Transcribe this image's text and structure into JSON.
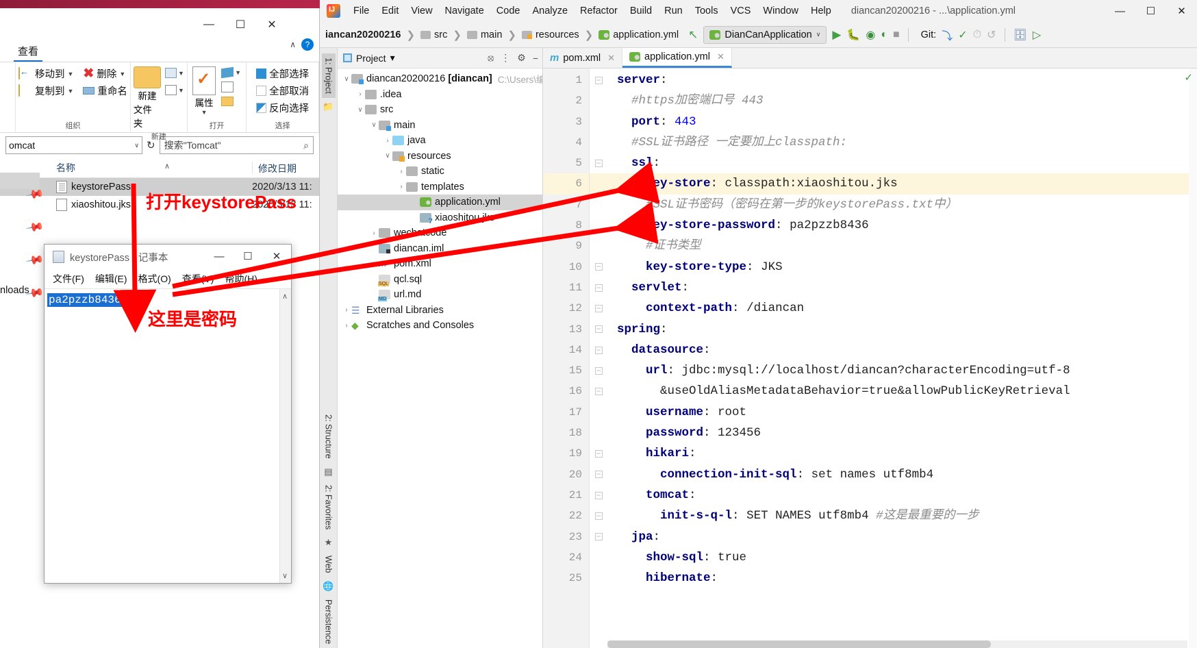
{
  "explorer": {
    "window_buttons": {
      "minimize": "—",
      "maximize": "☐",
      "close": "✕"
    },
    "help_glyph": "?",
    "chevron_glyph": "∧",
    "ribbon_tab": "查看",
    "groups": [
      {
        "label": "组织",
        "items": [
          "移动到",
          "删除",
          "复制到",
          "重命名"
        ]
      },
      {
        "label": "新建",
        "items": [
          "新建",
          "文件夹"
        ]
      },
      {
        "label": "打开",
        "items": [
          "属性"
        ]
      },
      {
        "label": "选择",
        "items": [
          "全部选择",
          "全部取消",
          "反向选择"
        ]
      }
    ],
    "address_value": "omcat",
    "address_caret": "∨",
    "refresh_glyph": "↻",
    "search_placeholder": "搜索\"Tomcat\"",
    "search_icon": "⌕",
    "columns": {
      "name": "名称",
      "date": "修改日期"
    },
    "sort_caret": "∧",
    "files": [
      {
        "name": "keystorePass",
        "date": "2020/3/13 11:",
        "selected": true
      },
      {
        "name": "xiaoshitou.jks",
        "date": "2020/3/13 11:",
        "selected": false
      }
    ],
    "sidebar_downloads": "nloads"
  },
  "notepad": {
    "title": "keystorePass - 记事本",
    "window_buttons": {
      "minimize": "—",
      "maximize": "☐",
      "close": "✕"
    },
    "menu": [
      "文件(F)",
      "编辑(E)",
      "格式(O)",
      "查看(V)",
      "帮助(H)"
    ],
    "content": "pa2pzzb8436",
    "scroll_up": "∧",
    "scroll_down": "∨"
  },
  "annotations": {
    "open_keystore": "打开keystorePass",
    "here_is_password": "这里是密码",
    "color": "#ff0000"
  },
  "idea": {
    "menu": [
      "File",
      "Edit",
      "View",
      "Navigate",
      "Code",
      "Analyze",
      "Refactor",
      "Build",
      "Run",
      "Tools",
      "VCS",
      "Window",
      "Help"
    ],
    "window_title": "diancan20200216 - ...\\application.yml",
    "window_buttons": {
      "minimize": "—",
      "maximize": "☐",
      "close": "✕"
    },
    "breadcrumbs": [
      "iancan20200216",
      "src",
      "main",
      "resources",
      "application.yml"
    ],
    "back_arrow": "↖",
    "run_config": "DianCanApplication",
    "run_config_caret": "∨",
    "toolbar_icons": [
      "run",
      "debug",
      "run-with-coverage",
      "profile",
      "stop"
    ],
    "git_label": "Git:",
    "git_icons": [
      "update-project",
      "commit",
      "history",
      "rollback"
    ],
    "right_icons": [
      "project-structure",
      "run-anything"
    ],
    "stripe_left": [
      "1: Project",
      "2: Structure",
      "2: Favorites",
      "Web",
      "Persistence"
    ],
    "project_pane": {
      "title": "Project",
      "title_caret": "▾",
      "actions": [
        "target-icon",
        "collapse-icon",
        "gear-icon",
        "hide-icon"
      ],
      "tree": [
        {
          "depth": 0,
          "twisty": "∨",
          "icon": "ic-folder-mod",
          "label": "diancan20200216",
          "bold": "[diancan]",
          "path": "C:\\Users\\编",
          "sel": false
        },
        {
          "depth": 1,
          "twisty": "›",
          "icon": "ic-folder",
          "label": ".idea",
          "sel": false
        },
        {
          "depth": 1,
          "twisty": "∨",
          "icon": "ic-folder",
          "label": "src",
          "sel": false
        },
        {
          "depth": 2,
          "twisty": "∨",
          "icon": "ic-folder-mod",
          "label": "main",
          "sel": false
        },
        {
          "depth": 3,
          "twisty": "›",
          "icon": "ic-folder-src",
          "label": "java",
          "sel": false
        },
        {
          "depth": 3,
          "twisty": "∨",
          "icon": "ic-folder-res",
          "label": "resources",
          "sel": false
        },
        {
          "depth": 4,
          "twisty": "›",
          "icon": "ic-folder",
          "label": "static",
          "sel": false
        },
        {
          "depth": 4,
          "twisty": "›",
          "icon": "ic-folder",
          "label": "templates",
          "sel": false
        },
        {
          "depth": 5,
          "twisty": "",
          "icon": "ic-yml",
          "label": "application.yml",
          "sel": true
        },
        {
          "depth": 5,
          "twisty": "",
          "icon": "ic-jks",
          "label": "xiaoshitou.jks",
          "sel": false
        },
        {
          "depth": 2,
          "twisty": "›",
          "icon": "ic-folder",
          "label": "wechatcode",
          "sel": false
        },
        {
          "depth": 2,
          "twisty": "",
          "icon": "ic-iml",
          "label": "diancan.iml",
          "sel": false
        },
        {
          "depth": 2,
          "twisty": "",
          "icon": "ic-mvn",
          "label": "pom.xml",
          "sel": false
        },
        {
          "depth": 2,
          "twisty": "",
          "icon": "ic-sql",
          "label": "qcl.sql",
          "sel": false
        },
        {
          "depth": 2,
          "twisty": "",
          "icon": "ic-md",
          "label": "url.md",
          "sel": false
        },
        {
          "depth": 0,
          "twisty": "›",
          "icon": "ic-lib",
          "label": "External Libraries",
          "sel": false
        },
        {
          "depth": 0,
          "twisty": "›",
          "icon": "ic-scratch",
          "label": "Scratches and Consoles",
          "sel": false
        }
      ]
    },
    "tabs": [
      {
        "label": "pom.xml",
        "icon": "maven-icon",
        "active": false,
        "close": "✕"
      },
      {
        "label": "application.yml",
        "icon": "yaml-icon",
        "active": true,
        "close": "✕"
      }
    ],
    "editor": {
      "file": "application.yml",
      "inspection_ok": "✓",
      "lines": [
        {
          "n": 1,
          "fold": "−",
          "hl": false,
          "tokens": [
            {
              "t": "k",
              "v": "server"
            },
            {
              "t": "p",
              "v": ":"
            }
          ]
        },
        {
          "n": 2,
          "fold": "",
          "hl": false,
          "tokens": [
            {
              "t": "p",
              "v": "  "
            },
            {
              "t": "cmt",
              "v": "#https加密端口号 443"
            }
          ]
        },
        {
          "n": 3,
          "fold": "",
          "hl": false,
          "tokens": [
            {
              "t": "p",
              "v": "  "
            },
            {
              "t": "k",
              "v": "port"
            },
            {
              "t": "p",
              "v": ": "
            },
            {
              "t": "num",
              "v": "443"
            }
          ]
        },
        {
          "n": 4,
          "fold": "",
          "hl": false,
          "tokens": [
            {
              "t": "p",
              "v": "  "
            },
            {
              "t": "cmt",
              "v": "#SSL证书路径 一定要加上classpath:"
            }
          ]
        },
        {
          "n": 5,
          "fold": "−",
          "hl": false,
          "tokens": [
            {
              "t": "p",
              "v": "  "
            },
            {
              "t": "k",
              "v": "ssl"
            },
            {
              "t": "p",
              "v": ":"
            }
          ]
        },
        {
          "n": 6,
          "fold": "",
          "hl": true,
          "tokens": [
            {
              "t": "p",
              "v": "    "
            },
            {
              "t": "k",
              "v": "key-store"
            },
            {
              "t": "p",
              "v": ": "
            },
            {
              "t": "val",
              "v": "classpath:xiaoshitou.jks"
            }
          ]
        },
        {
          "n": 7,
          "fold": "",
          "hl": false,
          "tokens": [
            {
              "t": "p",
              "v": "    "
            },
            {
              "t": "cmt",
              "v": "#SSL证书密码（密码在第一步的keystorePass.txt中）"
            }
          ]
        },
        {
          "n": 8,
          "fold": "",
          "hl": false,
          "tokens": [
            {
              "t": "p",
              "v": "    "
            },
            {
              "t": "k",
              "v": "key-store-password"
            },
            {
              "t": "p",
              "v": ": "
            },
            {
              "t": "val",
              "v": "pa2pzzb8436"
            }
          ]
        },
        {
          "n": 9,
          "fold": "",
          "hl": false,
          "tokens": [
            {
              "t": "p",
              "v": "    "
            },
            {
              "t": "cmt",
              "v": "#证书类型"
            }
          ]
        },
        {
          "n": 10,
          "fold": "−",
          "hl": false,
          "tokens": [
            {
              "t": "p",
              "v": "    "
            },
            {
              "t": "k",
              "v": "key-store-type"
            },
            {
              "t": "p",
              "v": ": "
            },
            {
              "t": "val",
              "v": "JKS"
            }
          ]
        },
        {
          "n": 11,
          "fold": "−",
          "hl": false,
          "tokens": [
            {
              "t": "p",
              "v": "  "
            },
            {
              "t": "k",
              "v": "servlet"
            },
            {
              "t": "p",
              "v": ":"
            }
          ]
        },
        {
          "n": 12,
          "fold": "−",
          "hl": false,
          "tokens": [
            {
              "t": "p",
              "v": "    "
            },
            {
              "t": "k",
              "v": "context-path"
            },
            {
              "t": "p",
              "v": ": "
            },
            {
              "t": "val",
              "v": "/diancan"
            }
          ]
        },
        {
          "n": 13,
          "fold": "−",
          "hl": false,
          "tokens": [
            {
              "t": "k",
              "v": "spring"
            },
            {
              "t": "p",
              "v": ":"
            }
          ]
        },
        {
          "n": 14,
          "fold": "−",
          "hl": false,
          "tokens": [
            {
              "t": "p",
              "v": "  "
            },
            {
              "t": "k",
              "v": "datasource"
            },
            {
              "t": "p",
              "v": ":"
            }
          ]
        },
        {
          "n": 15,
          "fold": "−",
          "hl": false,
          "tokens": [
            {
              "t": "p",
              "v": "    "
            },
            {
              "t": "k",
              "v": "url"
            },
            {
              "t": "p",
              "v": ": "
            },
            {
              "t": "val",
              "v": "jdbc:mysql://localhost/diancan?characterEncoding=utf-8"
            }
          ]
        },
        {
          "n": 16,
          "fold": "−",
          "hl": false,
          "tokens": [
            {
              "t": "p",
              "v": "      "
            },
            {
              "t": "val",
              "v": "&useOldAliasMetadataBehavior=true&allowPublicKeyRetrieval"
            }
          ]
        },
        {
          "n": 17,
          "fold": "",
          "hl": false,
          "tokens": [
            {
              "t": "p",
              "v": "    "
            },
            {
              "t": "k",
              "v": "username"
            },
            {
              "t": "p",
              "v": ": "
            },
            {
              "t": "val",
              "v": "root"
            }
          ]
        },
        {
          "n": 18,
          "fold": "",
          "hl": false,
          "tokens": [
            {
              "t": "p",
              "v": "    "
            },
            {
              "t": "k",
              "v": "password"
            },
            {
              "t": "p",
              "v": ": "
            },
            {
              "t": "val",
              "v": "123456"
            }
          ]
        },
        {
          "n": 19,
          "fold": "−",
          "hl": false,
          "tokens": [
            {
              "t": "p",
              "v": "    "
            },
            {
              "t": "k",
              "v": "hikari"
            },
            {
              "t": "p",
              "v": ":"
            }
          ]
        },
        {
          "n": 20,
          "fold": "−",
          "hl": false,
          "tokens": [
            {
              "t": "p",
              "v": "      "
            },
            {
              "t": "k",
              "v": "connection-init-sql"
            },
            {
              "t": "p",
              "v": ": "
            },
            {
              "t": "val",
              "v": "set names utf8mb4"
            }
          ]
        },
        {
          "n": 21,
          "fold": "−",
          "hl": false,
          "tokens": [
            {
              "t": "p",
              "v": "    "
            },
            {
              "t": "k",
              "v": "tomcat"
            },
            {
              "t": "p",
              "v": ":"
            }
          ]
        },
        {
          "n": 22,
          "fold": "−",
          "hl": false,
          "tokens": [
            {
              "t": "p",
              "v": "      "
            },
            {
              "t": "k",
              "v": "init-s-q-l"
            },
            {
              "t": "p",
              "v": ": "
            },
            {
              "t": "val",
              "v": "SET NAMES utf8mb4 "
            },
            {
              "t": "cmt",
              "v": "#这是最重要的一步"
            }
          ]
        },
        {
          "n": 23,
          "fold": "−",
          "hl": false,
          "tokens": [
            {
              "t": "p",
              "v": "  "
            },
            {
              "t": "k",
              "v": "jpa"
            },
            {
              "t": "p",
              "v": ":"
            }
          ]
        },
        {
          "n": 24,
          "fold": "",
          "hl": false,
          "tokens": [
            {
              "t": "p",
              "v": "    "
            },
            {
              "t": "k",
              "v": "show-sql"
            },
            {
              "t": "p",
              "v": ": "
            },
            {
              "t": "val",
              "v": "true"
            }
          ]
        },
        {
          "n": 25,
          "fold": "",
          "hl": false,
          "tokens": [
            {
              "t": "p",
              "v": "    "
            },
            {
              "t": "k",
              "v": "hibernate"
            },
            {
              "t": "p",
              "v": ":"
            }
          ]
        }
      ]
    }
  }
}
